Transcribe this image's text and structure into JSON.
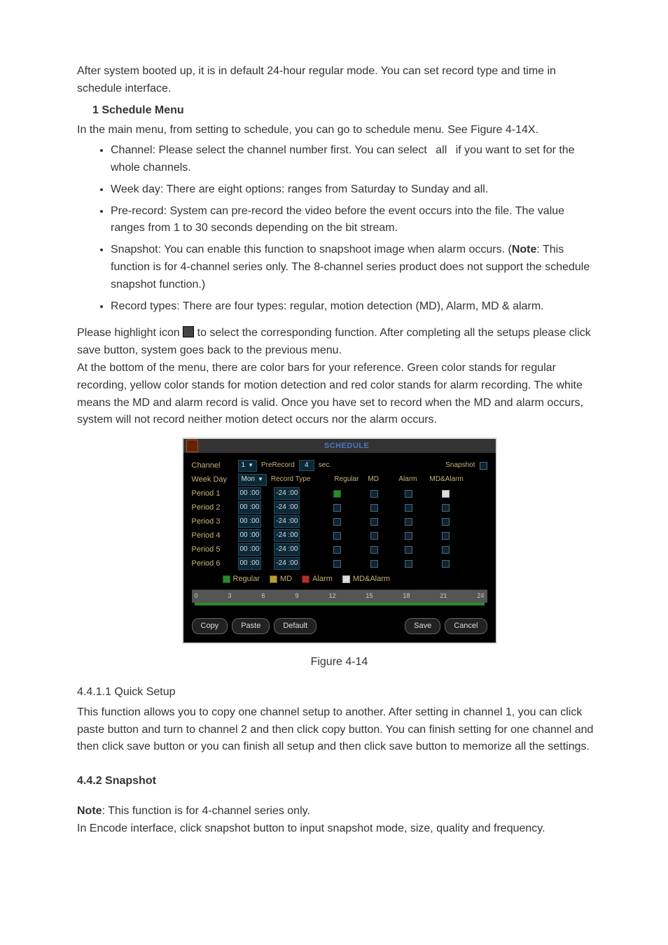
{
  "intro": "After system booted up, it is in default 24-hour regular mode. You can set record type and time in schedule interface.",
  "section1_title": "1 Schedule Menu",
  "section1_line": "In the main menu, from setting to schedule, you can go to schedule menu. See Figure 4-14X.",
  "bullets": [
    "Channel: Please select the channel number first. You can select  all  if you want to set for the whole channels.",
    "Week day: There are eight options: ranges from Saturday to Sunday and all.",
    "Pre-record: System can pre-record the video before the event occurs into the file. The value ranges from 1 to 30 seconds depending on the bit stream.",
    "Snapshot: You can enable this function to snapshoot image when alarm occurs. (",
    "Record types: There are four types: regular, motion detection (MD), Alarm, MD & alarm."
  ],
  "bullet4_note_label": "Note",
  "bullet4_rest": ": This function is for 4-channel series only. The 8-channel series product does not support the schedule snapshot function.)",
  "after_bullets_1a": "Please highlight icon ",
  "after_bullets_1b": " to select the corresponding function. After completing all the setups please click save button, system goes back to the previous menu.",
  "after_bullets_2": "At the bottom of the menu, there are color bars for your reference. Green color stands for regular recording, yellow color stands for motion detection and red color stands for alarm recording. The white means the MD and alarm record is valid. Once you have set to record when the MD and alarm occurs, system will not record neither motion detect occurs nor the alarm occurs.",
  "figure": {
    "title": "SCHEDULE",
    "labels": {
      "channel": "Channel",
      "prerecord": "PreRecord",
      "sec": "sec.",
      "snapshot": "Snapshot",
      "weekday": "Week Day",
      "recordtype": "Record Type",
      "regular": "Regular",
      "md": "MD",
      "alarm": "Alarm",
      "mdalarm": "MD&Alarm"
    },
    "values": {
      "channel": "1",
      "prerecord": "4",
      "weekday": "Mon"
    },
    "periods": [
      {
        "name": "Period 1",
        "from": "00 :00",
        "to": "-24 :00",
        "reg": true,
        "md": false,
        "al": false,
        "ma": true
      },
      {
        "name": "Period 2",
        "from": "00 :00",
        "to": "-24 :00",
        "reg": false,
        "md": false,
        "al": false,
        "ma": false
      },
      {
        "name": "Period 3",
        "from": "00 :00",
        "to": "-24 :00",
        "reg": false,
        "md": false,
        "al": false,
        "ma": false
      },
      {
        "name": "Period 4",
        "from": "00 :00",
        "to": "-24 :00",
        "reg": false,
        "md": false,
        "al": false,
        "ma": false
      },
      {
        "name": "Period 5",
        "from": "00 :00",
        "to": "-24 :00",
        "reg": false,
        "md": false,
        "al": false,
        "ma": false
      },
      {
        "name": "Period 6",
        "from": "00 :00",
        "to": "-24 :00",
        "reg": false,
        "md": false,
        "al": false,
        "ma": false
      }
    ],
    "legend": {
      "regular": "Regular",
      "md": "MD",
      "alarm": "Alarm",
      "mdalarm": "MD&Alarm"
    },
    "timeline": [
      "0",
      "3",
      "6",
      "9",
      "12",
      "15",
      "18",
      "21",
      "24"
    ],
    "buttons": {
      "copy": "Copy",
      "paste": "Paste",
      "default": "Default",
      "save": "Save",
      "cancel": "Cancel"
    }
  },
  "figure_caption": "Figure 4-14",
  "quick_setup_title": "4.4.1.1  Quick Setup",
  "quick_setup_body": "This function allows you to copy one channel setup to another. After setting in channel 1, you can click paste button and turn to channel 2 and then click copy button. You can finish setting for one channel and then click save button or you can finish all setup and then click save button to memorize all the settings.",
  "snapshot_title": "4.4.2  Snapshot",
  "snapshot_note_label": "Note",
  "snapshot_note": ": This function is for 4-channel series only.",
  "snapshot_body": "In Encode interface, click snapshot button to input snapshot mode, size, quality and frequency."
}
